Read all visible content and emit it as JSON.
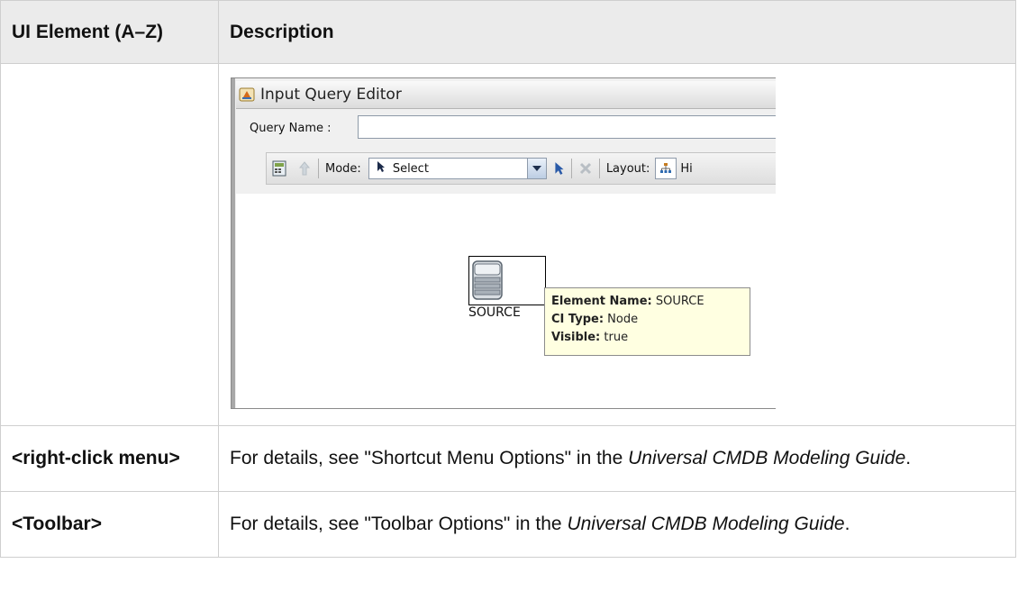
{
  "table": {
    "headers": [
      "UI Element (A–Z)",
      "Description"
    ],
    "rows": [
      {
        "name": "<right-click menu>",
        "desc_prefix": "For details, see \"Shortcut Menu Options\" in the ",
        "desc_italic": "Universal CMDB Modeling Guide",
        "desc_suffix": "."
      },
      {
        "name": "<Toolbar>",
        "desc_prefix": "For details, see \"Toolbar Options\" in the ",
        "desc_italic": "Universal CMDB Modeling Guide",
        "desc_suffix": "."
      }
    ]
  },
  "screenshot": {
    "window_title": "Input Query Editor",
    "query_name_label": "Query Name :",
    "query_name_value": "",
    "toolbar": {
      "mode_label": "Mode:",
      "mode_value": "Select",
      "layout_label": "Layout:",
      "layout_value_truncated": "Hi"
    },
    "node": {
      "label": "SOURCE"
    },
    "tooltip": {
      "name_key": "Element Name:",
      "name_value": "SOURCE",
      "type_key": "CI Type:",
      "type_value": "Node",
      "visible_key": "Visible:",
      "visible_value": "true"
    },
    "icons": [
      "app-icon",
      "calculator-icon",
      "up-arrow-icon",
      "pointer-icon",
      "dropdown-arrow-icon",
      "select-pointer-icon",
      "delete-icon",
      "hierarchy-layout-icon",
      "server-stack-icon"
    ]
  }
}
